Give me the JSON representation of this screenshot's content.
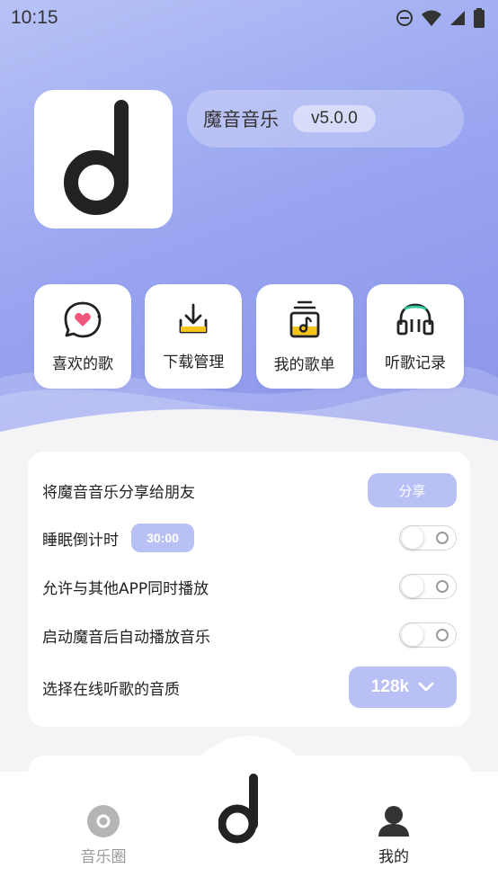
{
  "status_bar": {
    "time": "10:15"
  },
  "header": {
    "app_name": "魔音音乐",
    "version": "v5.0.0"
  },
  "quick_actions": [
    {
      "label": "喜欢的歌",
      "icon": "heart-chat-icon"
    },
    {
      "label": "下载管理",
      "icon": "download-icon"
    },
    {
      "label": "我的歌单",
      "icon": "playlist-icon"
    },
    {
      "label": "听歌记录",
      "icon": "headphones-icon"
    }
  ],
  "settings": {
    "share_label": "将魔音音乐分享给朋友",
    "share_button": "分享",
    "sleep_timer_label": "睡眠倒计时",
    "sleep_timer_value": "30:00",
    "mix_play_label": "允许与其他APP同时播放",
    "autoplay_label": "启动魔音后自动播放音乐",
    "quality_label": "选择在线听歌的音质",
    "quality_value": "128k"
  },
  "bottom_nav": {
    "left_label": "音乐圈",
    "right_label": "我的"
  },
  "colors": {
    "accent": "#b9c0f5",
    "hero_gradient_start": "#b7c2f6",
    "hero_gradient_end": "#8a94ea",
    "favorite_pink": "#f0557e",
    "download_yellow": "#f5c518"
  }
}
